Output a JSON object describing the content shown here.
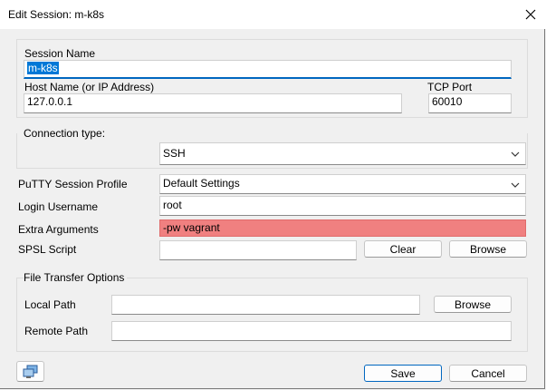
{
  "window": {
    "title": "Edit Session: m-k8s"
  },
  "session": {
    "name_label": "Session Name",
    "name_value": "m-k8s",
    "host_label": "Host Name (or IP Address)",
    "host_value": "127.0.0.1",
    "port_label": "TCP Port",
    "port_value": "60010"
  },
  "connection": {
    "label": "Connection type:",
    "type_value": "SSH"
  },
  "form": {
    "profile_label": "PuTTY Session Profile",
    "profile_value": "Default Settings",
    "login_label": "Login Username",
    "login_value": "root",
    "extra_label": "Extra Arguments",
    "extra_value": "-pw vagrant",
    "spsl_label": "SPSL Script",
    "spsl_value": "",
    "clear_label": "Clear",
    "browse_label": "Browse"
  },
  "transfer": {
    "label": "File Transfer Options",
    "local_label": "Local Path",
    "local_value": "",
    "local_browse_label": "Browse",
    "remote_label": "Remote Path",
    "remote_value": ""
  },
  "footer": {
    "save_label": "Save",
    "cancel_label": "Cancel",
    "session_icon": "computer-session-icon"
  },
  "colors": {
    "accent": "#0067c0",
    "selection": "#0078d7",
    "extra_args_bg": "#f08080"
  }
}
